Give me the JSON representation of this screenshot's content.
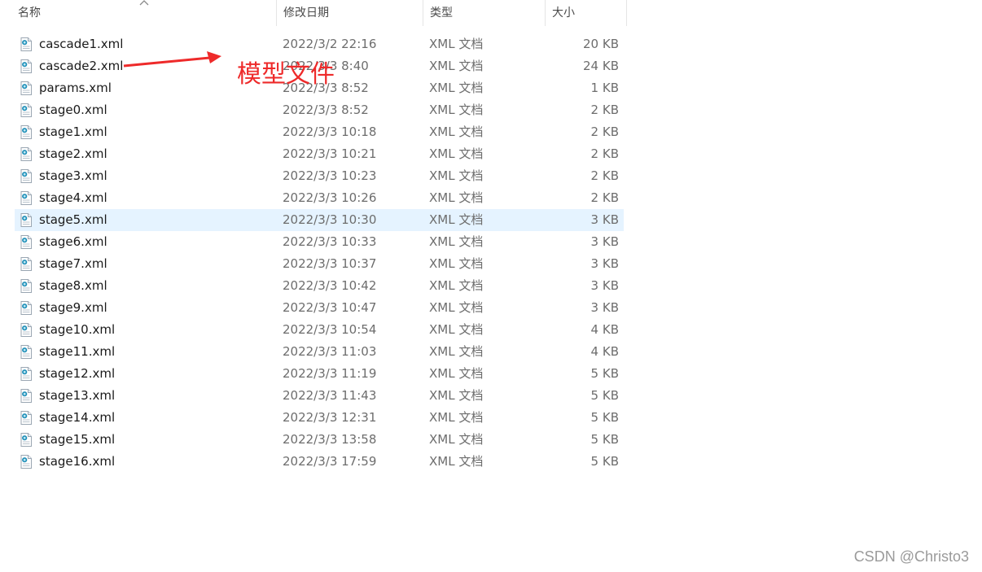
{
  "columns": {
    "name": "名称",
    "date": "修改日期",
    "type": "类型",
    "size": "大小"
  },
  "files": [
    {
      "name": "cascade1.xml",
      "date": "2022/3/2 22:16",
      "type": "XML 文档",
      "size": "20 KB"
    },
    {
      "name": "cascade2.xml",
      "date": "2022/3/3 8:40",
      "type": "XML 文档",
      "size": "24 KB"
    },
    {
      "name": "params.xml",
      "date": "2022/3/3 8:52",
      "type": "XML 文档",
      "size": "1 KB"
    },
    {
      "name": "stage0.xml",
      "date": "2022/3/3 8:52",
      "type": "XML 文档",
      "size": "2 KB"
    },
    {
      "name": "stage1.xml",
      "date": "2022/3/3 10:18",
      "type": "XML 文档",
      "size": "2 KB"
    },
    {
      "name": "stage2.xml",
      "date": "2022/3/3 10:21",
      "type": "XML 文档",
      "size": "2 KB"
    },
    {
      "name": "stage3.xml",
      "date": "2022/3/3 10:23",
      "type": "XML 文档",
      "size": "2 KB"
    },
    {
      "name": "stage4.xml",
      "date": "2022/3/3 10:26",
      "type": "XML 文档",
      "size": "2 KB"
    },
    {
      "name": "stage5.xml",
      "date": "2022/3/3 10:30",
      "type": "XML 文档",
      "size": "3 KB",
      "selected": true
    },
    {
      "name": "stage6.xml",
      "date": "2022/3/3 10:33",
      "type": "XML 文档",
      "size": "3 KB"
    },
    {
      "name": "stage7.xml",
      "date": "2022/3/3 10:37",
      "type": "XML 文档",
      "size": "3 KB"
    },
    {
      "name": "stage8.xml",
      "date": "2022/3/3 10:42",
      "type": "XML 文档",
      "size": "3 KB"
    },
    {
      "name": "stage9.xml",
      "date": "2022/3/3 10:47",
      "type": "XML 文档",
      "size": "3 KB"
    },
    {
      "name": "stage10.xml",
      "date": "2022/3/3 10:54",
      "type": "XML 文档",
      "size": "4 KB"
    },
    {
      "name": "stage11.xml",
      "date": "2022/3/3 11:03",
      "type": "XML 文档",
      "size": "4 KB"
    },
    {
      "name": "stage12.xml",
      "date": "2022/3/3 11:19",
      "type": "XML 文档",
      "size": "5 KB"
    },
    {
      "name": "stage13.xml",
      "date": "2022/3/3 11:43",
      "type": "XML 文档",
      "size": "5 KB"
    },
    {
      "name": "stage14.xml",
      "date": "2022/3/3 12:31",
      "type": "XML 文档",
      "size": "5 KB"
    },
    {
      "name": "stage15.xml",
      "date": "2022/3/3 13:58",
      "type": "XML 文档",
      "size": "5 KB"
    },
    {
      "name": "stage16.xml",
      "date": "2022/3/3 17:59",
      "type": "XML 文档",
      "size": "5 KB"
    }
  ],
  "annotation": {
    "label": "模型文件",
    "color": "#ee2a2a"
  },
  "watermark": "CSDN @Christo3",
  "icons": {
    "file": "xml-file-icon",
    "sort": "sort-up-chevron-icon"
  }
}
